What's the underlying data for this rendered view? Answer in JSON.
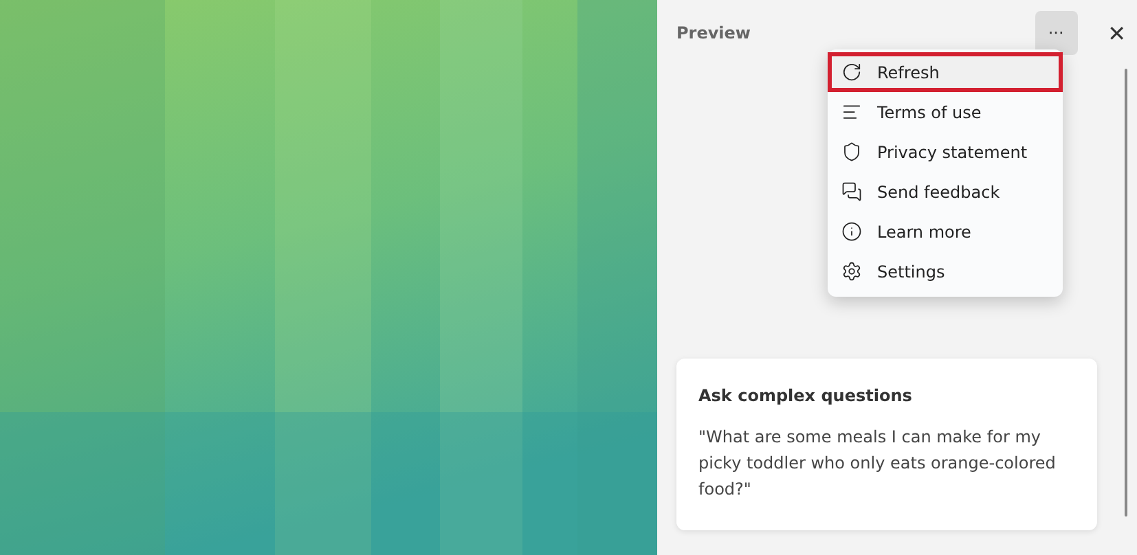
{
  "panel": {
    "title": "Preview",
    "more_button": "···",
    "close_button": "✕"
  },
  "menu": [
    {
      "kind": "refresh",
      "label": "Refresh",
      "selected": true
    },
    {
      "kind": "list",
      "label": "Terms of use",
      "selected": false
    },
    {
      "kind": "shield",
      "label": "Privacy statement",
      "selected": false
    },
    {
      "kind": "feedback",
      "label": "Send feedback",
      "selected": false
    },
    {
      "kind": "info",
      "label": "Learn more",
      "selected": false
    },
    {
      "kind": "gear",
      "label": "Settings",
      "selected": false
    }
  ],
  "card": {
    "title": "Ask complex questions",
    "text": "\"What are some meals I can make for my picky toddler who only eats orange-colored food?\""
  }
}
